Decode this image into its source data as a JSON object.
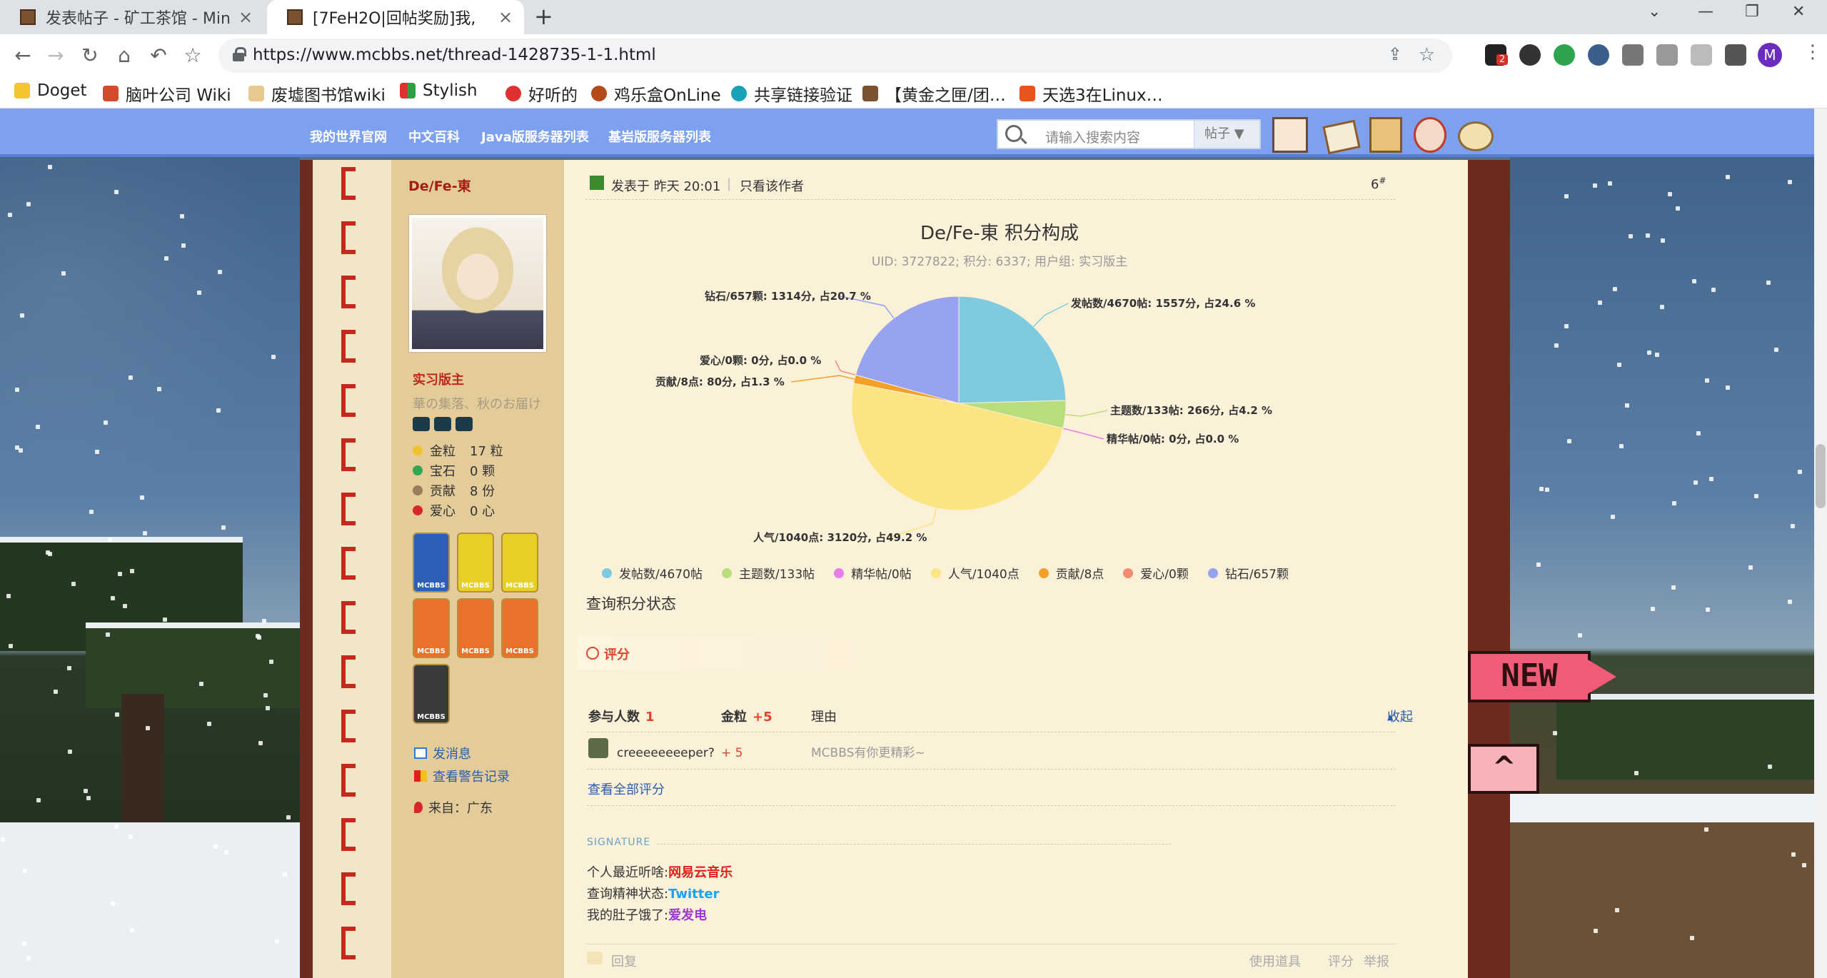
{
  "browser": {
    "tabs": [
      {
        "title": "发表帖子 - 矿工茶馆 - Min",
        "active": false
      },
      {
        "title": "[7FeH2O|回帖奖励]我,",
        "active": true
      }
    ],
    "url": "https://www.mcbbs.net/thread-1428735-1-1.html",
    "ext_badge": "2",
    "profile_initial": "M",
    "bookmarks": [
      "Doget",
      "脑叶公司 Wiki",
      "废墟图书馆wiki",
      "Stylish",
      "好听的",
      "鸡乐盒OnLine",
      "共享链接验证",
      "【黄金之匣/团…",
      "天选3在Linux…"
    ]
  },
  "site": {
    "nav": [
      "我的世界官网",
      "中文百科",
      "Java版服务器列表",
      "基岩版服务器列表"
    ],
    "search_placeholder": "请输入搜索内容",
    "search_scope": "帖子"
  },
  "author": {
    "name": "De/Fe-東",
    "rank": "实习版主",
    "motto": "華の集落、秋のお届け",
    "stats": [
      {
        "label": "金粒",
        "value": "17 粒",
        "color": "#f2c12e"
      },
      {
        "label": "宝石",
        "value": "0 颗",
        "color": "#2fa84f"
      },
      {
        "label": "贡献",
        "value": "8 份",
        "color": "#9a7b5a"
      },
      {
        "label": "爱心",
        "value": "0 心",
        "color": "#d8262b"
      }
    ],
    "medal_caption": "MCBBS",
    "links": {
      "message": "发消息",
      "warnings": "查看警告记录",
      "from": "来自：广东"
    }
  },
  "post": {
    "posted": "发表于 昨天 20:01",
    "separator": "|",
    "only_author": "只看该作者",
    "floor": "6",
    "floor_sup": "#"
  },
  "chart_data": {
    "type": "pie",
    "title": "De/Fe-東 积分构成",
    "subtitle": "UID: 3727822; 积分: 6337; 用户组: 实习版主",
    "slices": [
      {
        "name": "发帖数/4670帖",
        "label": "发帖数/4670帖: 1557分, 占24.6 %",
        "value": 1557,
        "percent": 24.6,
        "color": "#7ecbe0"
      },
      {
        "name": "主题数/133帖",
        "label": "主题数/133帖: 266分, 占4.2 %",
        "value": 266,
        "percent": 4.2,
        "color": "#b9dd7a"
      },
      {
        "name": "精华帖/0帖",
        "label": "精华帖/0帖: 0分, 占0.0 %",
        "value": 0,
        "percent": 0.0,
        "color": "#e67ee8"
      },
      {
        "name": "人气/1040点",
        "label": "人气/1040点: 3120分, 占49.2 %",
        "value": 3120,
        "percent": 49.2,
        "color": "#fce483"
      },
      {
        "name": "贡献/8点",
        "label": "贡献/8点: 80分, 占1.3 %",
        "value": 80,
        "percent": 1.3,
        "color": "#f3a028"
      },
      {
        "name": "爱心/0颗",
        "label": "爱心/0颗: 0分, 占0.0 %",
        "value": 0,
        "percent": 0.0,
        "color": "#f28b73"
      },
      {
        "name": "钻石/657颗",
        "label": "钻石/657颗: 1314分, 占20.7 %",
        "value": 1314,
        "percent": 20.7,
        "color": "#97a3f0"
      }
    ],
    "legend_position": "bottom"
  },
  "rating": {
    "query": "查询积分状态",
    "tab": "评分",
    "participants_label": "参与人数",
    "participants": "1",
    "gold_label": "金粒",
    "gold": "+5",
    "reason_label": "理由",
    "collapse": "收起",
    "rows": [
      {
        "user": "creeeeeeeeper?",
        "gold": "+ 5",
        "reason": "MCBBS有你更精彩~"
      }
    ],
    "view_all": "查看全部评分"
  },
  "signature": {
    "label": "SIGNATURE",
    "lines": [
      {
        "prefix": "个人最近听啥:",
        "value": "网易云音乐",
        "color": "#e0201a"
      },
      {
        "prefix": "查询精神状态:",
        "value": "Twitter",
        "color": "#1da1f2"
      },
      {
        "prefix": "我的肚子饿了:",
        "value": "爱发电",
        "color": "#9b3ad2"
      }
    ]
  },
  "footer": {
    "reply": "回复",
    "use_tool": "使用道具",
    "rate": "评分",
    "report": "举报"
  },
  "badges": {
    "new": "NEW"
  }
}
